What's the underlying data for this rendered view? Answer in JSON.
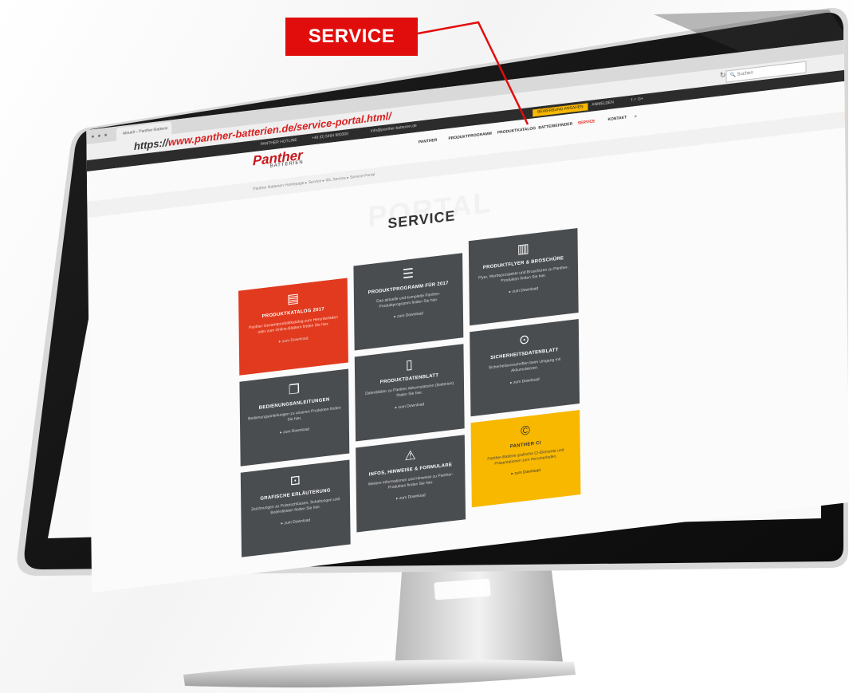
{
  "callout": {
    "label": "SERVICE"
  },
  "browser": {
    "tab_title": "Aktuell – Panther-Batterie",
    "url_prefix": "https://",
    "url_main": "www.panther-batterien.de/service-portal.html/",
    "search_placeholder": "Suchen"
  },
  "topbar": {
    "hotline": "PANTHER HOTLINE",
    "phone": "+49 (0) 5494 980300",
    "email": "info@panther-batterien.de",
    "cta": "BEWERBUNG ANSAHEN",
    "login": "ANMELDEN",
    "social": "f  ✓  G+"
  },
  "site": {
    "logo": "Panther",
    "logo_sub": "BATTERIEN",
    "breadcrumb": "Panther Batterien Homepage ▸ Service ▸ IDL Service ▸ Service-Portal"
  },
  "nav": {
    "items": [
      "PANTHER",
      "PRODUKTPROGRAMM",
      "PRODUKTKATALOG",
      "BATTERIEFINDER",
      "SERVICE",
      "KONTAKT"
    ]
  },
  "page": {
    "ghost_title": "PORTAL",
    "title": "SERVICE"
  },
  "tiles": [
    {
      "title": "PRODUKTKATALOG 2017",
      "desc": "Panther Gesamtproduktkatalog zum Herunterladen oder zum Online-Blättern finden Sie hier.",
      "link": "▸ zum Download",
      "icon": "book-icon"
    },
    {
      "title": "PRODUKTPROGRAMM FÜR 2017",
      "desc": "Das aktuelle und komplette Panther-Produktprogramm finden Sie hier.",
      "link": "▸ zum Download",
      "icon": "list-icon"
    },
    {
      "title": "PRODUKTFLYER & BROSCHÜRE",
      "desc": "Flyer, Werbeprospekte und Broschüren zu Panther-Produkten finden Sie hier.",
      "link": "▸ zum Download",
      "icon": "map-icon"
    },
    {
      "title": "BEDIENUNGSANLEITUNGEN",
      "desc": "Bedienungsanleitungen zu unseren Produkten finden Sie hier.",
      "link": "▸ zum Download",
      "icon": "documents-icon"
    },
    {
      "title": "PRODUKTDATENBLATT",
      "desc": "Datenblätter zu Panther Akkumulatoren (Batterien) finden Sie hier.",
      "link": "▸ zum Download",
      "icon": "file-icon"
    },
    {
      "title": "SICHERHEITSDATENBLATT",
      "desc": "Sicherheitsvorschriften beim Umgang mit Akkumulatoren.",
      "link": "▸ zum Download",
      "icon": "lock-icon"
    },
    {
      "title": "GRAFISCHE ERLÄUTERUNG",
      "desc": "Zeichnungen zu Polanschlüssen, Schaltungen und Bodenleisten finden Sie hier.",
      "link": "▸ zum Download",
      "icon": "diagram-icon"
    },
    {
      "title": "INFOS, HINWEISE & FORMULARE",
      "desc": "Weitere Informationen und Hinweise zu Panther-Produkten finden Sie hier.",
      "link": "▸ zum Download",
      "icon": "warning-icon"
    },
    {
      "title": "PANTHER CI",
      "desc": "Panther-Batterie grafische CI-Elemente und Präsentationen zum Herunterladen.",
      "link": "▸ zum Download",
      "icon": "copyright-icon"
    }
  ]
}
